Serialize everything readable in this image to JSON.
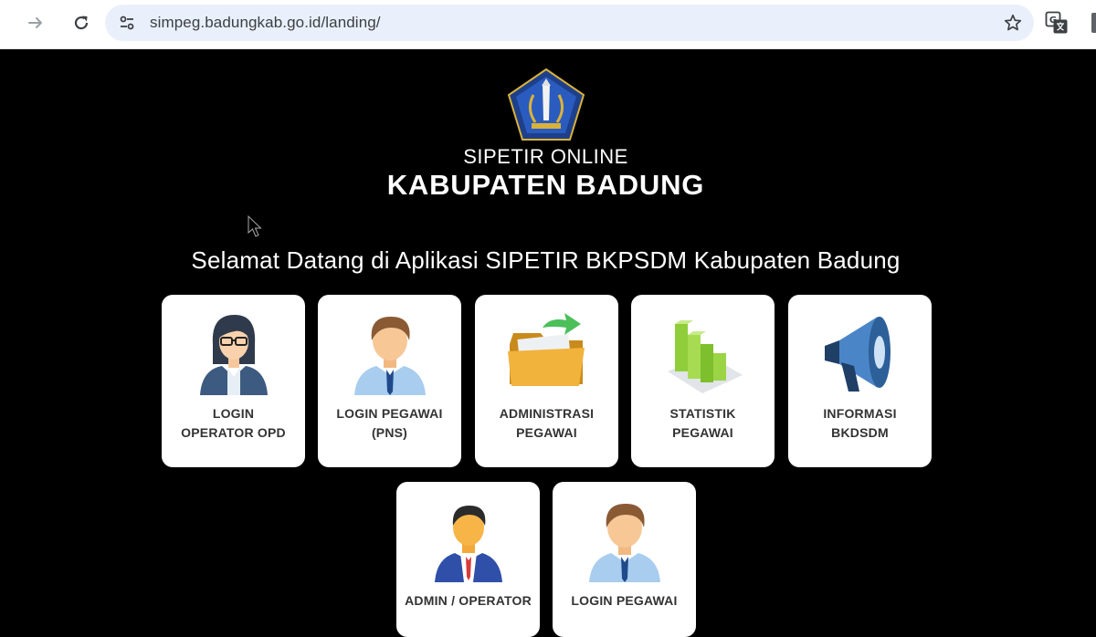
{
  "browser": {
    "url": "simpeg.badungkab.go.id/landing/"
  },
  "header": {
    "subtitle": "SIPETIR ONLINE",
    "title": "KABUPATEN BADUNG",
    "welcome": "Selamat Datang di Aplikasi SIPETIR BKPSDM Kabupaten Badung"
  },
  "menu": [
    {
      "line1": "LOGIN",
      "line2": "OPERATOR OPD",
      "icon": "woman-operator-icon"
    },
    {
      "line1": "LOGIN PEGAWAI",
      "line2": "(PNS)",
      "icon": "man-employee-icon"
    },
    {
      "line1": "ADMINISTRASI",
      "line2": "PEGAWAI",
      "icon": "folder-icon"
    },
    {
      "line1": "STATISTIK",
      "line2": "PEGAWAI",
      "icon": "bar-chart-icon"
    },
    {
      "line1": "INFORMASI",
      "line2": "BKDSDM",
      "icon": "megaphone-icon"
    },
    {
      "line1": "ADMIN / OPERATOR",
      "line2": "",
      "icon": "man-admin-icon"
    },
    {
      "line1": "LOGIN PEGAWAI",
      "line2": "",
      "icon": "man-employee-icon"
    }
  ]
}
